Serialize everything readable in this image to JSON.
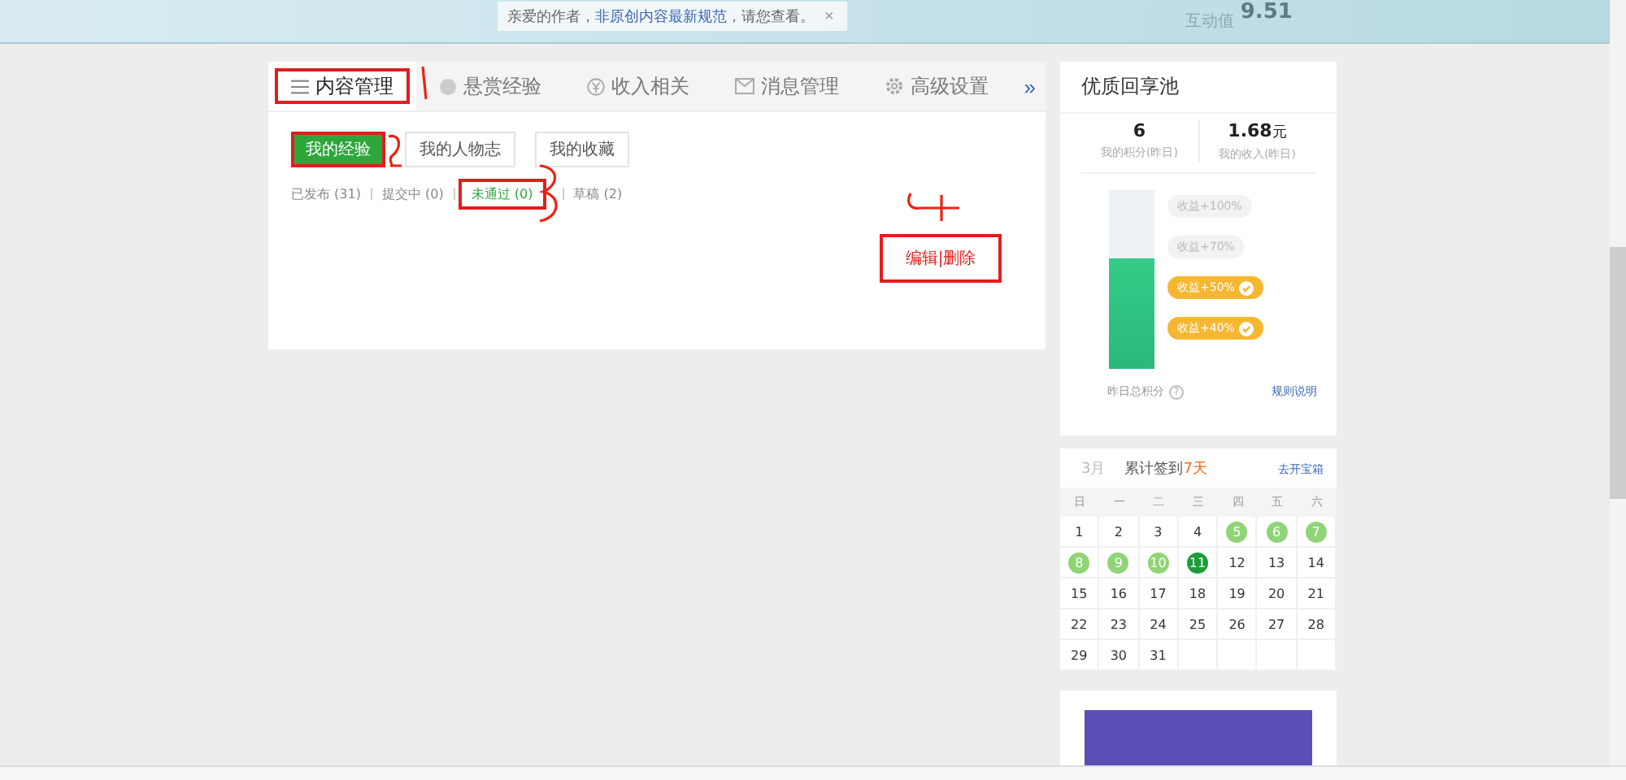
{
  "notice": {
    "prefix": "亲爱的作者，",
    "link": "非原创内容最新规范",
    "suffix": "，请您查看。",
    "close": "×"
  },
  "header_stat": {
    "label": "互动值",
    "value": "9.51"
  },
  "tabs": [
    {
      "label": "内容管理",
      "selected": true
    },
    {
      "label": "悬赏经验",
      "selected": false
    },
    {
      "label": "收入相关",
      "selected": false
    },
    {
      "label": "消息管理",
      "selected": false
    },
    {
      "label": "高级设置",
      "selected": false
    }
  ],
  "tabs_more": "»",
  "subtabs": [
    {
      "label": "我的经验",
      "selected": true
    },
    {
      "label": "我的人物志",
      "selected": false
    },
    {
      "label": "我的收藏",
      "selected": false
    }
  ],
  "filters": [
    {
      "label": "已发布 (31)",
      "selected": false
    },
    {
      "label": "提交中 (0)",
      "selected": false
    },
    {
      "label": "未通过 (0)",
      "selected": true
    },
    {
      "label": "草稿 (2)",
      "selected": false
    }
  ],
  "annotation_label": "编辑|删除",
  "pool": {
    "title": "优质回享池",
    "stats": [
      {
        "value": "6",
        "label": "我的积分(昨日)"
      },
      {
        "value": "1.68",
        "unit": "元",
        "label": "我的收入(昨日)"
      }
    ],
    "level": 0.62,
    "tiers": [
      {
        "label": "收益+100%",
        "reached": false
      },
      {
        "label": "收益+70%",
        "reached": false
      },
      {
        "label": "收益+50%",
        "reached": true
      },
      {
        "label": "收益+40%",
        "reached": true
      }
    ],
    "footer_label": "昨日总积分",
    "help": "?",
    "rules_link": "规则说明"
  },
  "calendar": {
    "month": "3月",
    "summary_prefix": "累计签到",
    "summary_days": "7天",
    "treasure_link": "去开宝箱",
    "weekdays": [
      "日",
      "一",
      "二",
      "三",
      "四",
      "五",
      "六"
    ],
    "days": [
      {
        "day": "1",
        "signed": false,
        "today": false
      },
      {
        "day": "2",
        "signed": false,
        "today": false
      },
      {
        "day": "3",
        "signed": false,
        "today": false
      },
      {
        "day": "4",
        "signed": false,
        "today": false
      },
      {
        "day": "5",
        "signed": true,
        "today": false
      },
      {
        "day": "6",
        "signed": true,
        "today": false
      },
      {
        "day": "7",
        "signed": true,
        "today": false
      },
      {
        "day": "8",
        "signed": true,
        "today": false
      },
      {
        "day": "9",
        "signed": true,
        "today": false
      },
      {
        "day": "10",
        "signed": true,
        "today": false
      },
      {
        "day": "11",
        "signed": true,
        "today": true
      },
      {
        "day": "12",
        "signed": false,
        "today": false
      },
      {
        "day": "13",
        "signed": false,
        "today": false
      },
      {
        "day": "14",
        "signed": false,
        "today": false
      },
      {
        "day": "15",
        "signed": false,
        "today": false
      },
      {
        "day": "16",
        "signed": false,
        "today": false
      },
      {
        "day": "17",
        "signed": false,
        "today": false
      },
      {
        "day": "18",
        "signed": false,
        "today": false
      },
      {
        "day": "19",
        "signed": false,
        "today": false
      },
      {
        "day": "20",
        "signed": false,
        "today": false
      },
      {
        "day": "21",
        "signed": false,
        "today": false
      },
      {
        "day": "22",
        "signed": false,
        "today": false
      },
      {
        "day": "23",
        "signed": false,
        "today": false
      },
      {
        "day": "24",
        "signed": false,
        "today": false
      },
      {
        "day": "25",
        "signed": false,
        "today": false
      },
      {
        "day": "26",
        "signed": false,
        "today": false
      },
      {
        "day": "27",
        "signed": false,
        "today": false
      },
      {
        "day": "28",
        "signed": false,
        "today": false
      },
      {
        "day": "29",
        "signed": false,
        "today": false
      },
      {
        "day": "30",
        "signed": false,
        "today": false
      },
      {
        "day": "31",
        "signed": false,
        "today": false
      }
    ]
  }
}
